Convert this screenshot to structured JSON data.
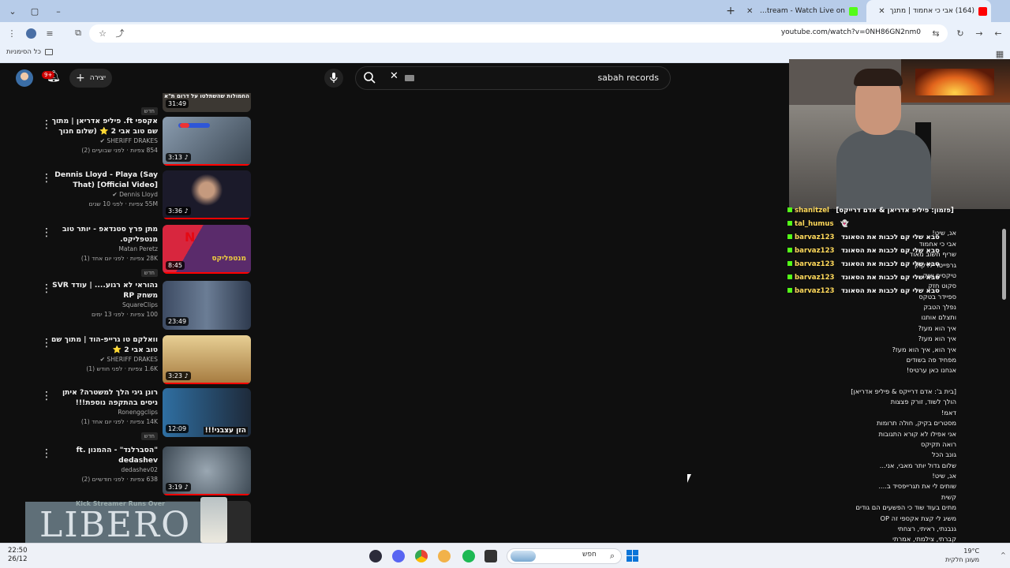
{
  "browser": {
    "tabs": [
      {
        "title": "(164) אבי כי אחמוד | מתנך",
        "favicon_color": "#ff0000",
        "active": true
      },
      {
        "title": "Shotist Stream - Watch Live on",
        "favicon_color": "#53fc18",
        "active": false
      }
    ],
    "url": "youtube.com/watch?v=0NH86GN2nm0",
    "bookmarks_label": "כל הסימניות"
  },
  "youtube": {
    "create_label": "יצירה",
    "notification_count": "9+",
    "search_query": "sabah records",
    "recommendations": [
      {
        "title": "החמולות שהשתלטו על דרום ת\"א",
        "channel": "",
        "meta": "",
        "badge": "חדש",
        "duration": "31:49",
        "thumb_color": "#3c3833"
      },
      {
        "title": "אקספי ft. פיליפ אדריאן | מתוך שם טוב אבי 2 ⭐ (שלום חנוך עולה...",
        "channel": "SHERIFF DRAKES",
        "meta": "854 צפיות · לפני שבועיים (2)",
        "badge": "",
        "duration": "3:13",
        "thumb_color": "#6a7d8e"
      },
      {
        "title": "Dennis Lloyd - Playa (Say That) [Official Video]",
        "channel": "Dennis Lloyd",
        "meta": "55M צפיות · לפני 10 שנים",
        "badge": "",
        "duration": "3:36",
        "thumb_color": "#1b1a2a"
      },
      {
        "title": "מתן פרץ סטנדאפ - יותר טוב מנטפליקס.",
        "channel": "Matan Peretz",
        "meta": "28K צפיות · לפני יום אחד (1)",
        "badge": "חדש",
        "duration": "8:45",
        "thumb_color": "#5a2b6b"
      },
      {
        "title": "נהוראי לא רגוע.... | עודד SVR משחק RP",
        "channel": "SquareClips",
        "meta": "100 צפיות · לפני 13 ימים",
        "badge": "",
        "duration": "23:49",
        "thumb_color": "#2e3a4e"
      },
      {
        "title": "וואלקם טו גרייפ-הוד | מתוך שם טוב אבי 2 ⭐",
        "channel": "SHERIFF DRAKES",
        "meta": "1.6K צפיות · לפני חודש (1)",
        "badge": "",
        "duration": "3:23",
        "thumb_color": "#c7a56a"
      },
      {
        "title": "רונן גיגי הלך למשטרה? איתן ניסים בהתקפה נוספת!!!",
        "channel": "Ronenggclips",
        "meta": "14K צפיות · לפני יום אחד (1)",
        "badge": "חדש",
        "duration": "12:09",
        "thumb_color": "#2f6fa2"
      },
      {
        "title": "\"הסברלנד\" - ההמנון ft. dedashev",
        "channel": "dedashev02",
        "meta": "638 צפיות · לפני חודשיים (2)",
        "badge": "",
        "duration": "3:19",
        "thumb_color": "#6d7e8e"
      }
    ]
  },
  "stream_overlay": {
    "chat": [
      {
        "user": "shanitzel",
        "message": "[פזמון: פיליפ אדריאן & אדם דרייקס]"
      },
      {
        "user": "tal_humus",
        "message": "👻"
      },
      {
        "user": "barvaz123",
        "message": "סבא שלי קם לכבות את הסאונד"
      },
      {
        "user": "barvaz123",
        "message": "סבא שלי קם לכבות את הסאונד"
      },
      {
        "user": "barvaz123",
        "message": "סבא שלי קם לכבות את הסאונד"
      },
      {
        "user": "barvaz123",
        "message": "סבא שלי קם לכבות את הסאונד"
      },
      {
        "user": "barvaz123",
        "message": "סבא שלי קם לכבות את הסאונד"
      }
    ],
    "lyrics": [
      "",
      "אנ, שיט!",
      "אבי כי אחמוד",
      "שריף חשוב מאוד",
      "גרפייטר לדקוק",
      "טיקסים שוק",
      "סקוט חזק",
      "ספיידר בטקס",
      "נפלך הטבק",
      "ותצלם אותנו",
      "איך הוא מעז?",
      "איך הוא מעז?",
      "איך הוא, איך הוא מעז?",
      "מפחיד פה בשודים",
      "אנחנו כאן ערטיס!",
      "",
      "[בית ב': אדם דרייקס & פיליפ אדריאן]",
      "הולך לשוד, זורק פצצות",
      "דאמ!",
      "מסטרים בקיק, חולה תרומות",
      "אני אפילו לא קורא התגובות",
      "רואה תקיקס",
      "גונב הכל",
      "שלום גדול יותר מאבי, אני...",
      "אנ, שיט!",
      "שותים לי את תגרייפסיד ב....",
      "קשית",
      "מתים בעוד שוד כי הפשעים הם גודים",
      "משיג לי קצת אקספי זה OP",
      "גנבנתי, ראיתי, רצחתי",
      "קברתי, צילמתי, אמרתי",
      "כתבתי לסקוט"
    ],
    "ad_brand": "LIBERO",
    "kick_caption": "Kick Streamer Runs Over"
  },
  "taskbar": {
    "time": "22:50",
    "date": "26/12",
    "search_label": "חפש",
    "temperature": "19°C",
    "weather_text": "מעונן חלקית"
  }
}
